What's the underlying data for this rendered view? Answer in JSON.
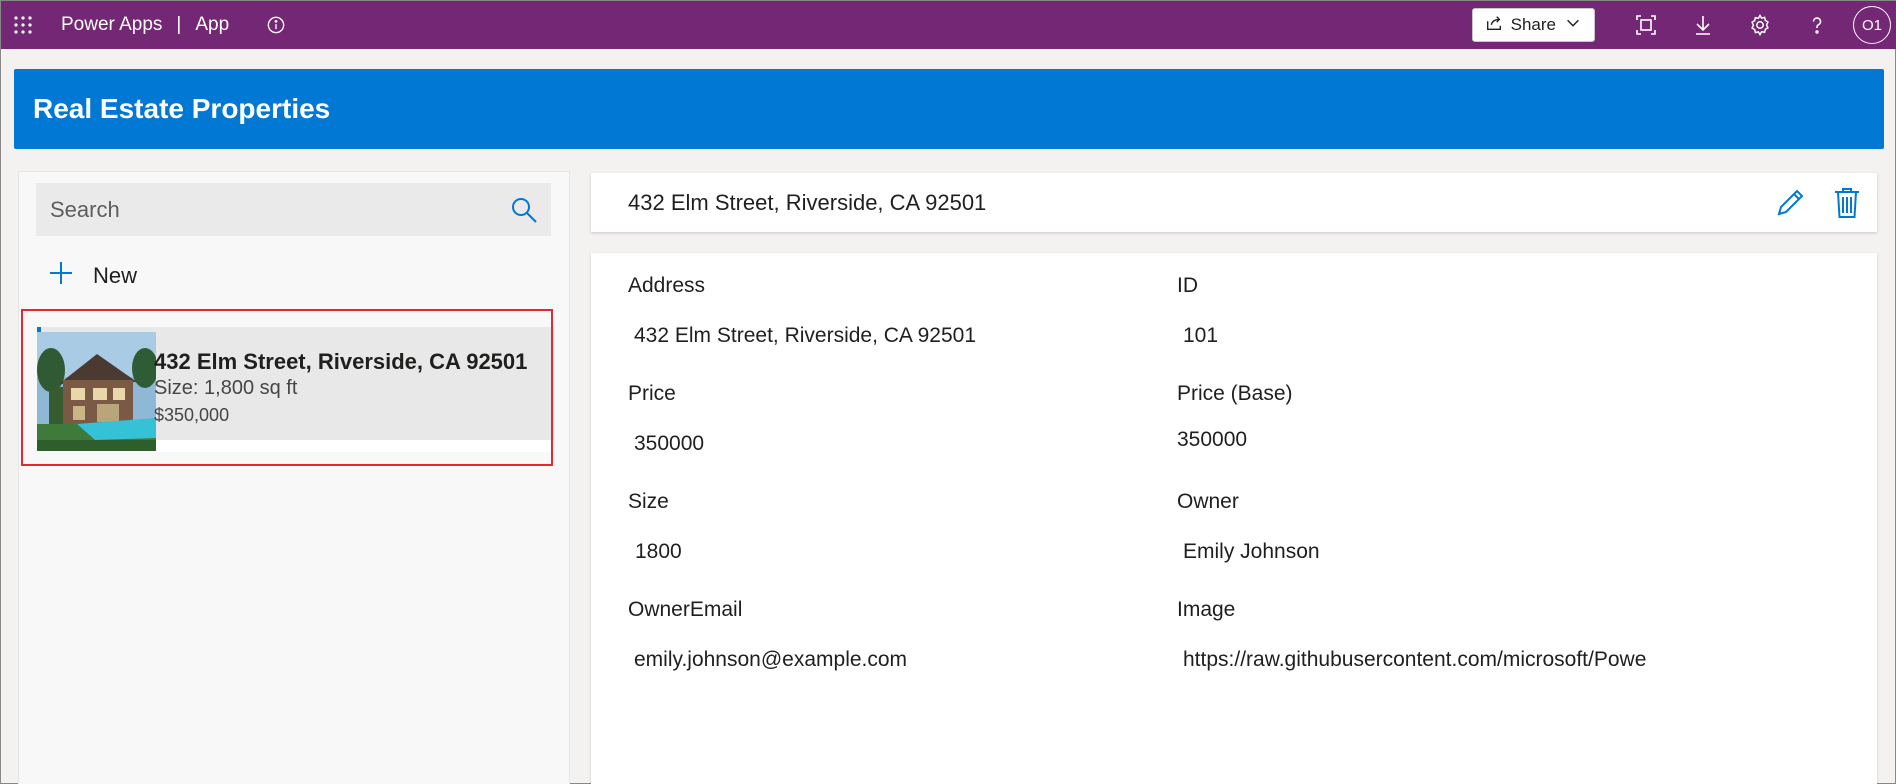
{
  "topbar": {
    "app_name": "Power Apps",
    "separator": "|",
    "app_label": "App",
    "share_label": "Share",
    "avatar_initials": "O1",
    "icons": [
      "waffle-icon",
      "info-icon",
      "share-icon",
      "chevron-down-icon",
      "fit-screen-icon",
      "download-icon",
      "gear-icon",
      "help-icon"
    ]
  },
  "header": {
    "title": "Real Estate Properties"
  },
  "colors": {
    "topbar": "#742774",
    "header": "#0078d4",
    "accent": "#0078d4",
    "highlight_border": "#e8262e"
  },
  "gallery": {
    "search_placeholder": "Search",
    "new_label": "New",
    "items": [
      {
        "title": "432 Elm Street, Riverside, CA 92501",
        "size": "Size: 1,800 sq ft",
        "price": "$350,000",
        "image": "house-photo"
      }
    ]
  },
  "detail": {
    "title": "432 Elm Street, Riverside, CA 92501",
    "fields": {
      "address": {
        "label": "Address",
        "value": "432 Elm Street, Riverside, CA 92501"
      },
      "id": {
        "label": "ID",
        "value": "101"
      },
      "price": {
        "label": "Price",
        "value": "350000"
      },
      "price_base": {
        "label": "Price (Base)",
        "value": "350000"
      },
      "size": {
        "label": "Size",
        "value": "1800"
      },
      "owner": {
        "label": "Owner",
        "value": "Emily Johnson"
      },
      "owner_email": {
        "label": "OwnerEmail",
        "value": "emily.johnson@example.com"
      },
      "image": {
        "label": "Image",
        "value": "https://raw.githubusercontent.com/microsoft/Powe"
      }
    }
  }
}
